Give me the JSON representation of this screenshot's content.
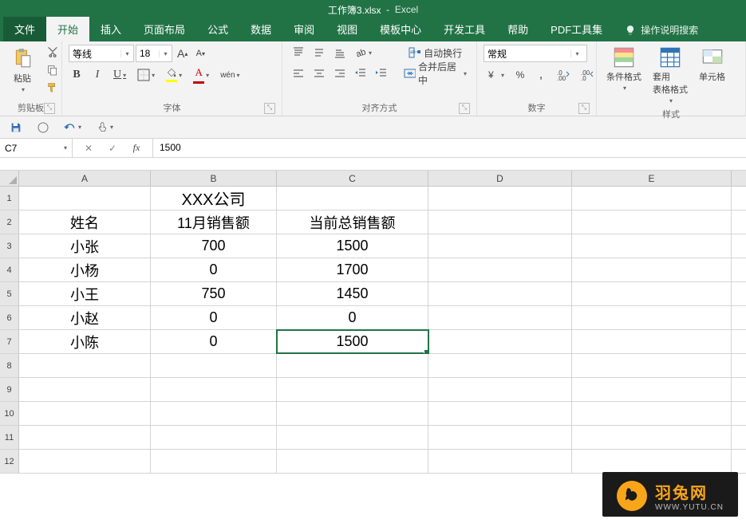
{
  "app": {
    "filename": "工作簿3.xlsx",
    "app_name": "Excel"
  },
  "tabs": {
    "file": "文件",
    "home": "开始",
    "insert": "插入",
    "layout": "页面布局",
    "formulas": "公式",
    "data": "数据",
    "review": "审阅",
    "view": "视图",
    "templates": "模板中心",
    "developer": "开发工具",
    "help": "帮助",
    "pdf": "PDF工具集",
    "tell_me": "操作说明搜索"
  },
  "ribbon": {
    "clipboard": {
      "paste": "粘贴",
      "label": "剪贴板"
    },
    "font": {
      "name": "等线",
      "size": "18",
      "increase": "A",
      "decrease": "A",
      "bold": "B",
      "italic": "I",
      "underline": "U",
      "wen": "wén",
      "label": "字体"
    },
    "alignment": {
      "wrap": "自动换行",
      "merge": "合并后居中",
      "label": "对齐方式"
    },
    "number": {
      "format": "常规",
      "label": "数字"
    },
    "styles": {
      "cond": "条件格式",
      "table": "套用\n表格格式",
      "cell": "单元格",
      "label": "样式"
    }
  },
  "formula_bar": {
    "cell_ref": "C7",
    "cancel": "✕",
    "confirm": "✓",
    "fx": "fx",
    "value": "1500"
  },
  "columns": [
    "A",
    "B",
    "C",
    "D",
    "E"
  ],
  "row_nums": [
    "1",
    "2",
    "3",
    "4",
    "5",
    "6",
    "7",
    "8",
    "9",
    "10",
    "11",
    "12"
  ],
  "sheet": {
    "title": "XXX公司",
    "headers": {
      "a": "姓名",
      "b": "11月销售额",
      "c": "当前总销售额"
    },
    "rows": [
      {
        "a": "小张",
        "b": "700",
        "c": "1500"
      },
      {
        "a": "小杨",
        "b": "0",
        "c": "1700"
      },
      {
        "a": "小王",
        "b": "750",
        "c": "1450"
      },
      {
        "a": "小赵",
        "b": "0",
        "c": "0"
      },
      {
        "a": "小陈",
        "b": "0",
        "c": "1500"
      }
    ]
  },
  "selected": {
    "row": 7,
    "col": "C"
  },
  "watermark": {
    "name": "羽兔网",
    "url": "WWW.YUTU.CN"
  },
  "chart_data": {
    "type": "table",
    "title": "XXX公司",
    "columns": [
      "姓名",
      "11月销售额",
      "当前总销售额"
    ],
    "rows": [
      [
        "小张",
        700,
        1500
      ],
      [
        "小杨",
        0,
        1700
      ],
      [
        "小王",
        750,
        1450
      ],
      [
        "小赵",
        0,
        0
      ],
      [
        "小陈",
        0,
        1500
      ]
    ]
  }
}
